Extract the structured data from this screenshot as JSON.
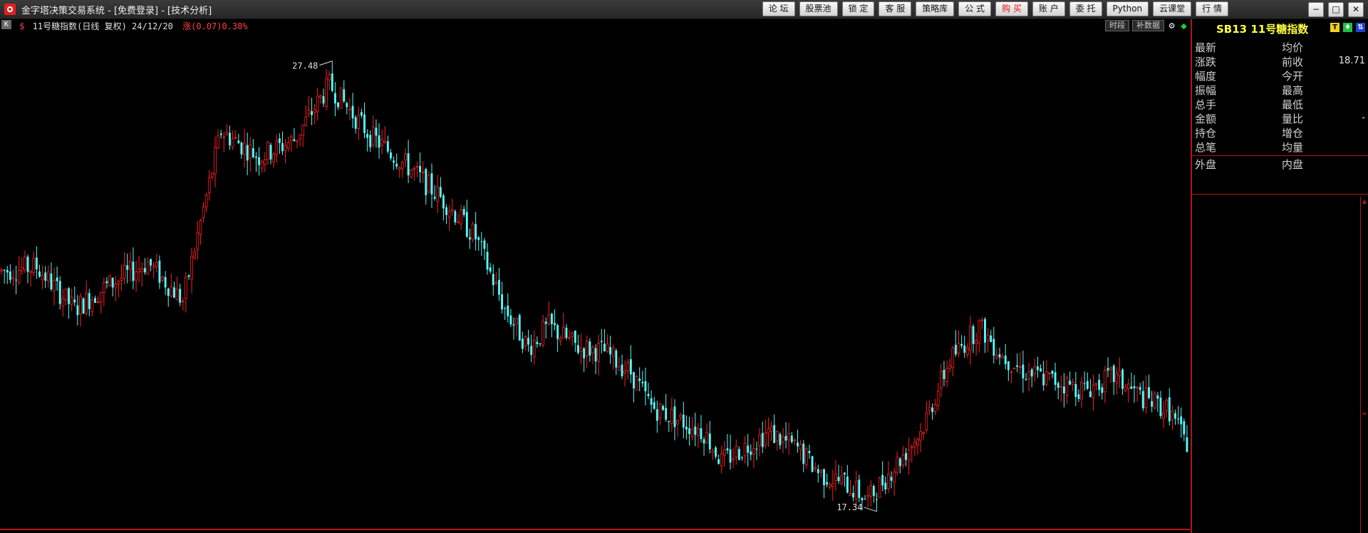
{
  "window": {
    "title": "金字塔决策交易系统 - [免费登录] - [技术分析]",
    "toolbar": [
      "论 坛",
      "股票池",
      "锁 定",
      "客 服",
      "策略库",
      "公 式",
      "购 买",
      "账 户",
      "委 托",
      "Python",
      "云课堂",
      "行 情"
    ],
    "controls": {
      "minimize": "−",
      "maximize": "□",
      "close": "✕"
    }
  },
  "chart_header": {
    "box_icon": "K",
    "symbol_mark": "$",
    "name": "11号糖指数(日线 复权) 24/12/20",
    "change": "涨(0.07)0.38%",
    "buttons": [
      "时段",
      "补数据"
    ],
    "icons": [
      "gear-icon",
      "diamond-icon"
    ]
  },
  "chart_data": {
    "type": "candlestick",
    "title": "",
    "xlabel": "",
    "ylabel": "",
    "max_label": "27.48",
    "min_label": "17.34",
    "ylim": [
      17.0,
      28.1
    ],
    "up_color": "#ff2020",
    "down_color": "#54fcfc",
    "anchors": [
      [
        0,
        22.9
      ],
      [
        12,
        23.0
      ],
      [
        25,
        22.0
      ],
      [
        35,
        22.5
      ],
      [
        50,
        23.1
      ],
      [
        62,
        22.2
      ],
      [
        75,
        26.2
      ],
      [
        88,
        25.6
      ],
      [
        100,
        26.0
      ],
      [
        112,
        27.3
      ],
      [
        126,
        26.1
      ],
      [
        140,
        25.3
      ],
      [
        152,
        24.5
      ],
      [
        162,
        23.7
      ],
      [
        172,
        22.0
      ],
      [
        180,
        21.1
      ],
      [
        187,
        21.6
      ],
      [
        197,
        21.1
      ],
      [
        206,
        21.0
      ],
      [
        215,
        20.5
      ],
      [
        222,
        19.7
      ],
      [
        234,
        19.3
      ],
      [
        240,
        19.1
      ],
      [
        246,
        18.4
      ],
      [
        253,
        18.7
      ],
      [
        262,
        19.1
      ],
      [
        272,
        18.7
      ],
      [
        280,
        18.1
      ],
      [
        288,
        17.9
      ],
      [
        296,
        17.5
      ],
      [
        303,
        18.1
      ],
      [
        314,
        19.1
      ],
      [
        324,
        20.8
      ],
      [
        334,
        21.6
      ],
      [
        342,
        20.9
      ],
      [
        350,
        20.5
      ],
      [
        360,
        20.3
      ],
      [
        370,
        20.1
      ],
      [
        380,
        20.4
      ],
      [
        390,
        19.9
      ],
      [
        399,
        19.6
      ],
      [
        405,
        18.8
      ]
    ]
  },
  "panel": {
    "symbol": "SB13 11号糖指数",
    "icons": [
      "T",
      "♦",
      "⇅"
    ],
    "rows": [
      {
        "l1": "最新",
        "l2": "均价",
        "v2": ""
      },
      {
        "l1": "涨跌",
        "l2": "前收",
        "v2": "18.71"
      },
      {
        "l1": "幅度",
        "l2": "今开",
        "v2": ""
      },
      {
        "l1": "振幅",
        "l2": "最高",
        "v2": ""
      },
      {
        "l1": "总手",
        "l2": "最低",
        "v2": ""
      },
      {
        "l1": "金额",
        "l2": "量比",
        "v2": "-"
      },
      {
        "l1": "持仓",
        "l2": "增仓",
        "v2": ""
      },
      {
        "l1": "总笔",
        "l2": "均量",
        "v2": ""
      }
    ],
    "volume_row": {
      "l1": "外盘",
      "l2": "内盘"
    }
  }
}
